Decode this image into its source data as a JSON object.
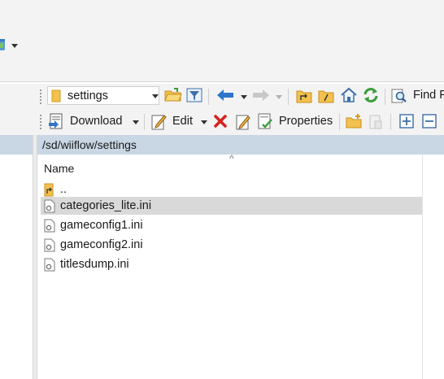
{
  "top_toolbar": {
    "icon": "sync-icon"
  },
  "nav_toolbar": {
    "folder_combo": {
      "value": "settings"
    },
    "find_label": "Find F"
  },
  "action_toolbar": {
    "download_label": "Download",
    "edit_label": "Edit",
    "properties_label": "Properties"
  },
  "path_bar": {
    "path": "/sd/wiiflow/settings"
  },
  "file_list": {
    "column_header": "Name",
    "sort_indicator": "^",
    "rows": [
      {
        "name": "..",
        "icon": "parent-folder-icon",
        "selected": false
      },
      {
        "name": "categories_lite.ini",
        "icon": "ini-file-icon",
        "selected": true
      },
      {
        "name": "gameconfig1.ini",
        "icon": "ini-file-icon",
        "selected": false
      },
      {
        "name": "gameconfig2.ini",
        "icon": "ini-file-icon",
        "selected": false
      },
      {
        "name": "titlesdump.ini",
        "icon": "ini-file-icon",
        "selected": false
      }
    ]
  },
  "colors": {
    "path_bar_bg": "#c9d6e3",
    "selection_bg": "#d9d9d9",
    "toolbar_bg": "#f3f3f3"
  }
}
